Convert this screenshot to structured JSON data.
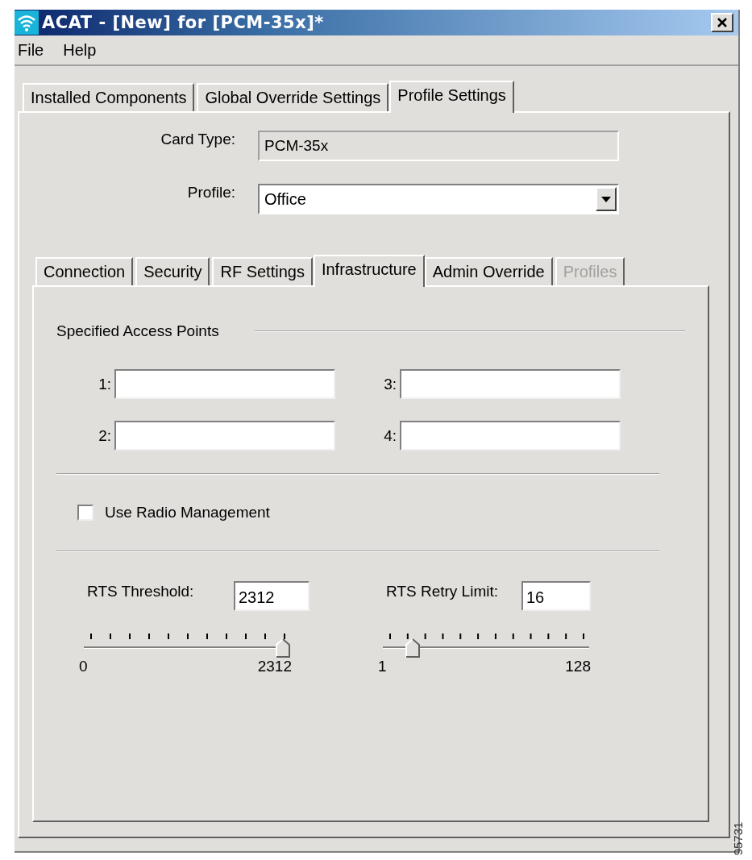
{
  "window": {
    "title": "ACAT - [New] for [PCM-35x]*"
  },
  "menu": [
    "File",
    "Help"
  ],
  "tabs": [
    {
      "label": "Installed Components",
      "selected": false
    },
    {
      "label": "Global Override Settings",
      "selected": false
    },
    {
      "label": "Profile Settings",
      "selected": true
    }
  ],
  "card_type": {
    "label": "Card Type:",
    "value": "PCM-35x"
  },
  "profile": {
    "label": "Profile:",
    "value": "Office"
  },
  "sub_tabs": [
    {
      "label": "Connection",
      "selected": false,
      "disabled": false
    },
    {
      "label": "Security",
      "selected": false,
      "disabled": false
    },
    {
      "label": "RF Settings",
      "selected": false,
      "disabled": false
    },
    {
      "label": "Infrastructure",
      "selected": true,
      "disabled": false
    },
    {
      "label": "Admin Override",
      "selected": false,
      "disabled": false
    },
    {
      "label": "Profiles",
      "selected": false,
      "disabled": true
    }
  ],
  "access_points": {
    "title": "Specified Access Points",
    "fields": [
      {
        "label": "1:"
      },
      {
        "label": "3:"
      },
      {
        "label": "2:"
      },
      {
        "label": "4:"
      }
    ]
  },
  "use_radio_management": {
    "label": "Use Radio Management",
    "checked": false
  },
  "rts": [
    {
      "label": "RTS Threshold:",
      "value": "2312",
      "level": 1,
      "min": "0",
      "max": "2312"
    },
    {
      "label": "RTS Retry Limit:",
      "value": "16",
      "level": 0.118,
      "min": "1",
      "max": "128"
    }
  ],
  "figure_id": "95731"
}
